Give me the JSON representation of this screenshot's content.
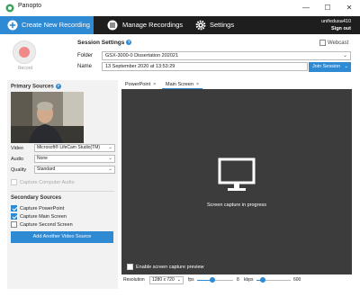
{
  "window": {
    "title": "Panopto",
    "controls": {
      "minimize": "—",
      "maximize": "☐",
      "close": "✕"
    }
  },
  "tabs": [
    {
      "label": "Create New Recording",
      "icon": "plus-circle-icon",
      "active": true
    },
    {
      "label": "Manage Recordings",
      "icon": "list-icon",
      "active": false
    },
    {
      "label": "Settings",
      "icon": "gear-icon",
      "active": false
    }
  ],
  "user": {
    "name": "unifedusa410",
    "signout": "Sign out"
  },
  "record": {
    "label": "Record"
  },
  "session": {
    "heading": "Session Settings",
    "webcast_label": "Webcast",
    "folder_label": "Folder",
    "folder_value": "GSX-3000-0 Dissertation 202021",
    "name_label": "Name",
    "name_value": "13 September 2020 at 13:53:29",
    "join_label": "Join Session"
  },
  "primary": {
    "heading": "Primary Sources",
    "video_label": "Video",
    "video_value": "Microsoft® LifeCam Studio(TM)",
    "audio_label": "Audio",
    "audio_value": "None",
    "quality_label": "Quality",
    "quality_value": "Standard",
    "capture_audio_label": "Capture Computer Audio"
  },
  "secondary": {
    "heading": "Secondary Sources",
    "items": [
      {
        "label": "Capture PowerPoint",
        "checked": true
      },
      {
        "label": "Capture Main Screen",
        "checked": true
      },
      {
        "label": "Capture Second Screen",
        "checked": false
      }
    ],
    "add_label": "Add Another Video Source"
  },
  "preview": {
    "tabs": [
      {
        "label": "PowerPoint",
        "active": false
      },
      {
        "label": "Main Screen",
        "active": true
      }
    ],
    "close_glyph": "×",
    "status": "Screen capture in progress",
    "enable_label": "Enable screen capture preview"
  },
  "bottom": {
    "resolution_label": "Resolution",
    "resolution_value": "1280 x 720",
    "fps_label": "fps",
    "fps_value": 8,
    "kbps_label": "kbps",
    "kbps_value": 600
  },
  "colors": {
    "accent": "#2f8ad4",
    "tabbar": "#1e1e1e",
    "preview_bg": "#3c3c3c"
  }
}
